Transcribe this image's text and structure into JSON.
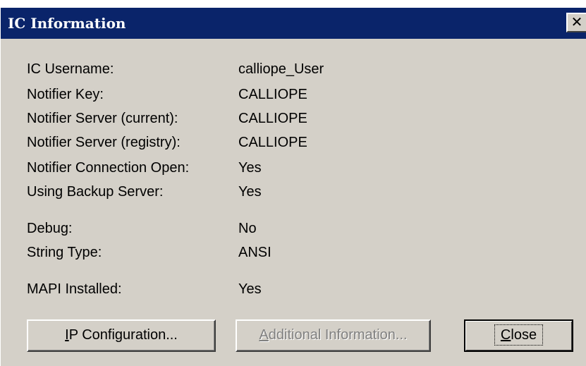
{
  "window": {
    "title": "IC Information",
    "close_glyph": "✕"
  },
  "info": [
    {
      "label": "IC Username:",
      "value": "calliope_User"
    },
    {
      "label": "Notifier Key:",
      "value": "CALLIOPE"
    },
    {
      "label": "Notifier Server (current):",
      "value": "CALLIOPE"
    },
    {
      "label": "Notifier Server (registry):",
      "value": "CALLIOPE"
    },
    {
      "label": "Notifier Connection Open:",
      "value": "Yes"
    },
    {
      "label": "Using Backup Server:",
      "value": "Yes"
    },
    {
      "label": "Debug:",
      "value": "No"
    },
    {
      "label": "String Type:",
      "value": "ANSI"
    },
    {
      "label": "MAPI Installed:",
      "value": "Yes"
    }
  ],
  "buttons": {
    "ip_config": {
      "mnemonic": "I",
      "rest": "P Configuration..."
    },
    "additional": {
      "mnemonic": "A",
      "rest": "dditional Information...",
      "enabled": false
    },
    "close": {
      "mnemonic": "C",
      "rest": "lose"
    }
  },
  "colors": {
    "titlebar": "#0a246a",
    "dialog_bg": "#d4d0c8",
    "disabled_text": "#808080"
  }
}
